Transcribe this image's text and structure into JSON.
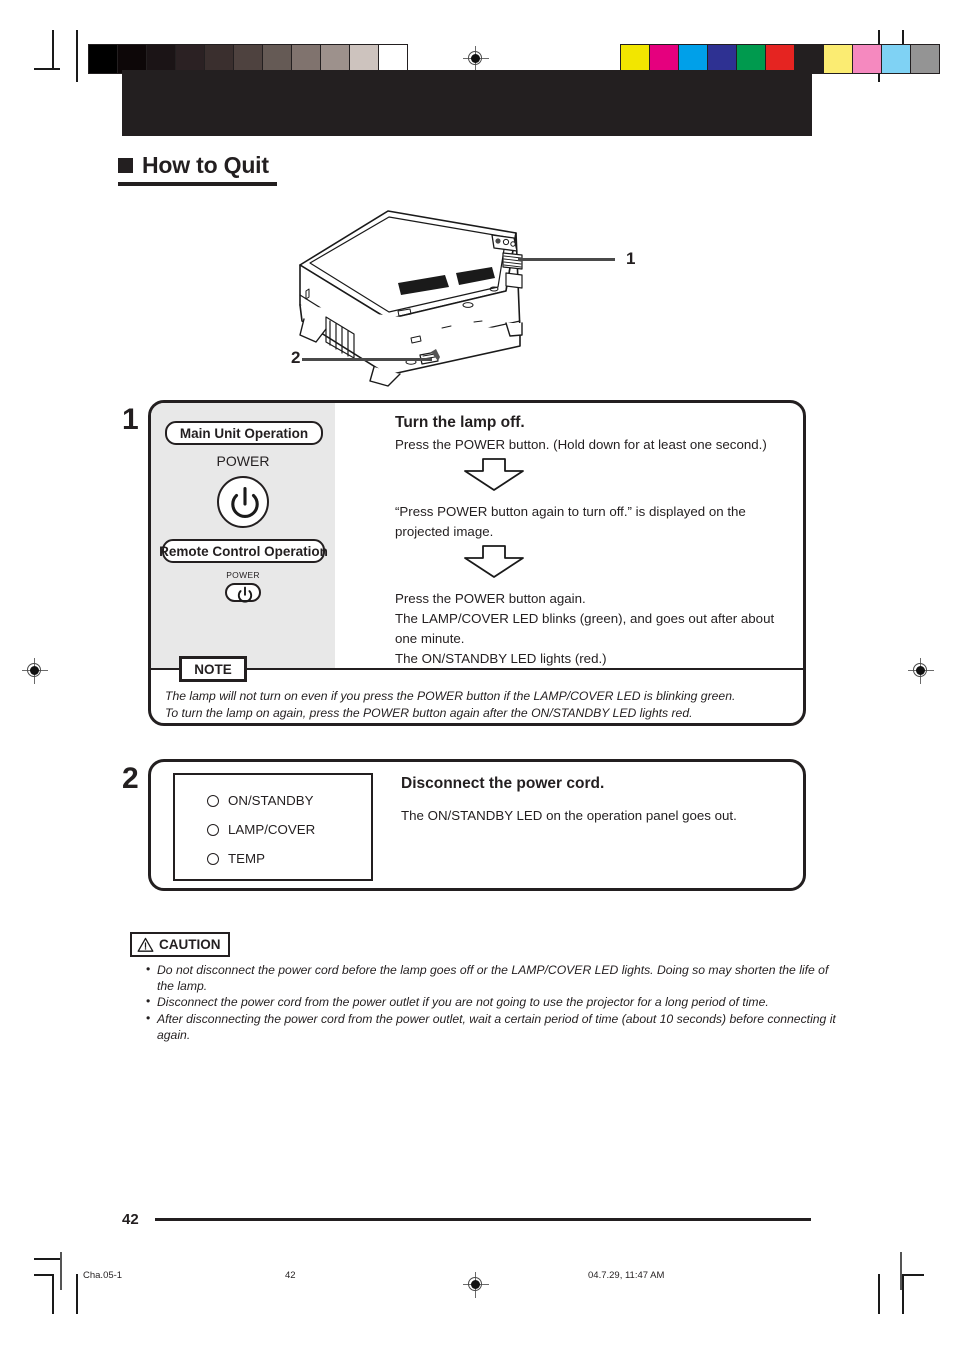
{
  "page": {
    "heading": "How to Quit",
    "page_number": "42"
  },
  "illustration": {
    "callout_1": "1",
    "callout_2": "2",
    "alt": "projector-rear-view"
  },
  "steps": [
    {
      "number": "1",
      "title": "Turn the lamp off.",
      "panel": {
        "main_unit_label": "Main Unit Operation",
        "main_power_label": "POWER",
        "remote_label": "Remote Control Operation",
        "remote_power_label": "POWER"
      },
      "paragraphs": [
        "Press the POWER button. (Hold down for at least one second.)",
        "“Press POWER button again to turn off.” is displayed on the projected image.",
        "Press the POWER button again.\nThe LAMP/COVER LED blinks (green), and goes out after about one minute.\nThe ON/STANDBY LED lights (red.)"
      ],
      "para_1": "Press the POWER button. (Hold down for at least one second.)",
      "para_2": "“Press POWER button again to turn off.” is displayed on the projected image.",
      "para_3_line_1": "Press the POWER button again.",
      "para_3_line_2": "The LAMP/COVER LED blinks (green), and goes out after about one minute.",
      "para_3_line_3": "The ON/STANDBY LED lights (red.)",
      "note": {
        "label": "NOTE",
        "line_1": "The lamp will not turn on even if you press the POWER button if the LAMP/COVER LED is blinking green.",
        "line_2": "To turn the lamp on again, press the POWER button again after the ON/STANDBY LED lights red."
      }
    },
    {
      "number": "2",
      "title": "Disconnect the power cord.",
      "body": "The ON/STANDBY LED on the operation panel goes out.",
      "leds": [
        {
          "label": "ON/STANDBY"
        },
        {
          "label": "LAMP/COVER"
        },
        {
          "label": "TEMP"
        }
      ]
    }
  ],
  "caution": {
    "label": "CAUTION",
    "items": [
      "Do not disconnect the power cord before the lamp goes off or the LAMP/COVER LED lights. Doing so may shorten the life of the lamp.",
      "Disconnect the power cord from the power outlet if you are not going to use the projector for a long period of time.",
      "After disconnecting the power cord from the power outlet, wait a certain period of time (about 10 seconds) before connecting it again."
    ],
    "item_1": "Do not disconnect the power cord before the lamp goes off or the LAMP/COVER LED lights. Doing so may shorten the life of the lamp.",
    "item_2": "Disconnect the power cord from the power outlet if you are not going to use the projector for a long period of time.",
    "item_3": "After disconnecting the power cord from the power outlet, wait a certain period of time (about 10 seconds) before connecting it again."
  },
  "imprint": {
    "file": "Cha.05-1",
    "page": "42",
    "date": "04.7.29, 11:47 AM"
  },
  "print_marks": {
    "grayscale_swatches": [
      "#000000",
      "#0d0708",
      "#1b1416",
      "#2b2123",
      "#3a2f2e",
      "#4e423f",
      "#655a55",
      "#80736e",
      "#9d918c",
      "#cdc3be",
      "#ffffff"
    ],
    "color_swatches": [
      "#f2e600",
      "#e5007e",
      "#00a0e9",
      "#2e3192",
      "#009a4e",
      "#e52421",
      "#231f20",
      "#fbec72",
      "#f589bf",
      "#7fd2f4",
      "#949494"
    ]
  }
}
